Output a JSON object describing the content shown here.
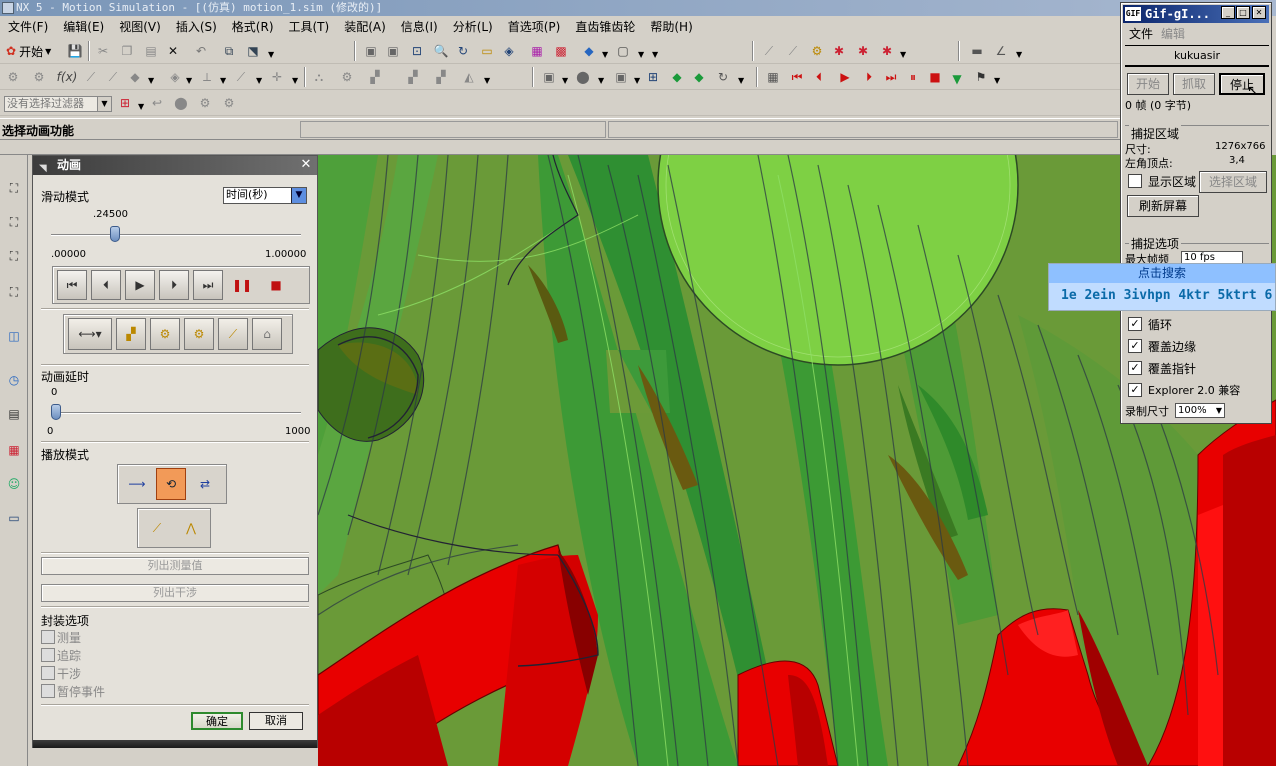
{
  "window": {
    "title": "NX 5 - Motion Simulation - [(仿真) motion_1.sim (修改的)]",
    "menus": [
      "文件(F)",
      "编辑(E)",
      "视图(V)",
      "插入(S)",
      "格式(R)",
      "工具(T)",
      "装配(A)",
      "信息(I)",
      "分析(L)",
      "首选项(P)",
      "直齿锥齿轮",
      "帮助(H)"
    ]
  },
  "toolbar": {
    "start_label": "开始",
    "filter_placeholder": "没有选择过滤器"
  },
  "status": {
    "prompt": "选择动画功能"
  },
  "animation_dialog": {
    "title": "动画",
    "slide_mode_label": "滑动模式",
    "slide_mode_value": "时间(秒)",
    "time_slider": {
      "value": 0.245,
      "value_label": ".24500",
      "min_label": ".00000",
      "max_label": "1.00000"
    },
    "delay_label": "动画延时",
    "delay_slider": {
      "value": 0,
      "value_label": "0",
      "min_label": "0",
      "max_label": "1000"
    },
    "playback_mode_label": "播放模式",
    "list_measure_label": "列出测量值",
    "list_interference_label": "列出干涉",
    "package_options_label": "封装选项",
    "package_options": [
      "测量",
      "追踪",
      "干涉",
      "暂停事件"
    ],
    "ok_label": "确定",
    "cancel_label": "取消"
  },
  "gif_recorder": {
    "title": "Gif-gI...",
    "menus": [
      "文件",
      "编辑"
    ],
    "user": "kukuasir",
    "buttons": {
      "start": "开始",
      "capture": "抓取",
      "stop": "停止"
    },
    "frame_info": "0 帧 (0 字节)",
    "capture_area_label": "捕捉区域",
    "size_label": "尺寸:",
    "size_value": "1276x766",
    "corner_label": "左角顶点:",
    "corner_value": "3,4",
    "show_area_label": "显示区域",
    "select_area_label": "选择区域",
    "refresh_label": "刷新屏幕",
    "capture_options_label": "捕捉选项",
    "max_fps_label": "最大帧频",
    "max_fps_value": "10 fps",
    "checks": [
      {
        "label": "循环",
        "checked": true
      },
      {
        "label": "覆盖边缘",
        "checked": true
      },
      {
        "label": "覆盖指针",
        "checked": true
      },
      {
        "label": "Explorer 2.0 兼容",
        "checked": true
      }
    ],
    "record_size_label": "录制尺寸",
    "record_size_value": "100%"
  },
  "ad_popup": {
    "header": "点击搜索",
    "line": "1e 2ein 3ivhpn 4ktr 5ktrt 6"
  },
  "colors": {
    "viewport_green": "#6a9d3a",
    "bright_green": "#7ed044",
    "gear_red": "#e80000",
    "dialog_bg": "#e4e1da",
    "title_blue": "#0a246a"
  }
}
